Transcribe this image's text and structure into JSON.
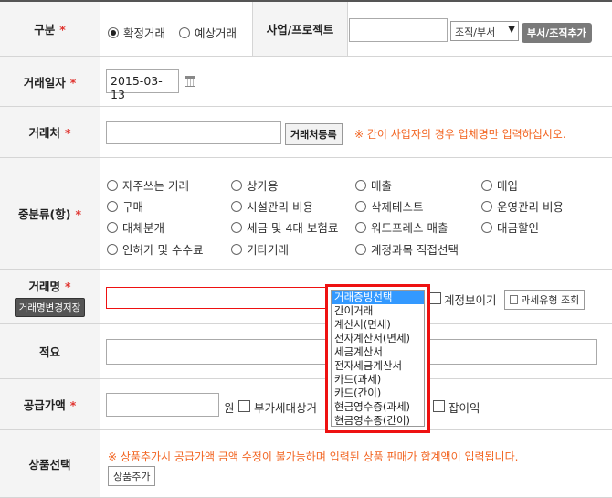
{
  "row1": {
    "label": "구분",
    "required_mark": "*",
    "radio_confirmed": "확정거래",
    "radio_expected": "예상거래",
    "project_label": "사업/프로젝트",
    "org_select": "조직/부서",
    "org_button": "부서/조직추가"
  },
  "row2": {
    "label": "거래일자",
    "required_mark": "*",
    "date_value": "2015-03-13"
  },
  "row3": {
    "label": "거래처",
    "required_mark": "*",
    "register_button": "거래처등록",
    "notice": "※ 간이 사업자의 경우 업체명만 입력하십시오."
  },
  "row4": {
    "label": "중분류(항)",
    "required_mark": "*",
    "options": [
      "자주쓰는 거래",
      "상가용",
      "매출",
      "매입",
      "구매",
      "시설관리 비용",
      "삭제테스트",
      "운영관리 비용",
      "대체분개",
      "세금 및 4대 보험료",
      "워드프레스 매출",
      "대금할인",
      "인허가 및 수수료",
      "기타거래",
      "계정과목 직접선택"
    ]
  },
  "row5": {
    "label": "거래명",
    "required_mark": "*",
    "save_button": "거래명변경저장",
    "account_view": "계정보이기",
    "tax_type_button": "과세유형 조회"
  },
  "row6": {
    "label": "적요"
  },
  "row7": {
    "label": "공급가액",
    "required_mark": "*",
    "unit": "원",
    "vat_label": "부가세대상거",
    "misc_label": "잡이익"
  },
  "row8": {
    "label": "상품선택",
    "notice": "※ 상품추가시 공급가액 금액 수정이 불가능하며 입력된 상품 판매가 합계액이 입력됩니다.",
    "add_button": "상품추가"
  },
  "dropdown": {
    "items": [
      "거래증빙선택",
      "간이거래",
      "계산서(면세)",
      "전자계산서(면세)",
      "세금계산서",
      "전자세금계산서",
      "카드(과세)",
      "카드(간이)",
      "현금영수증(과세)",
      "현금영수증(간이)"
    ],
    "selected_index": 0
  }
}
